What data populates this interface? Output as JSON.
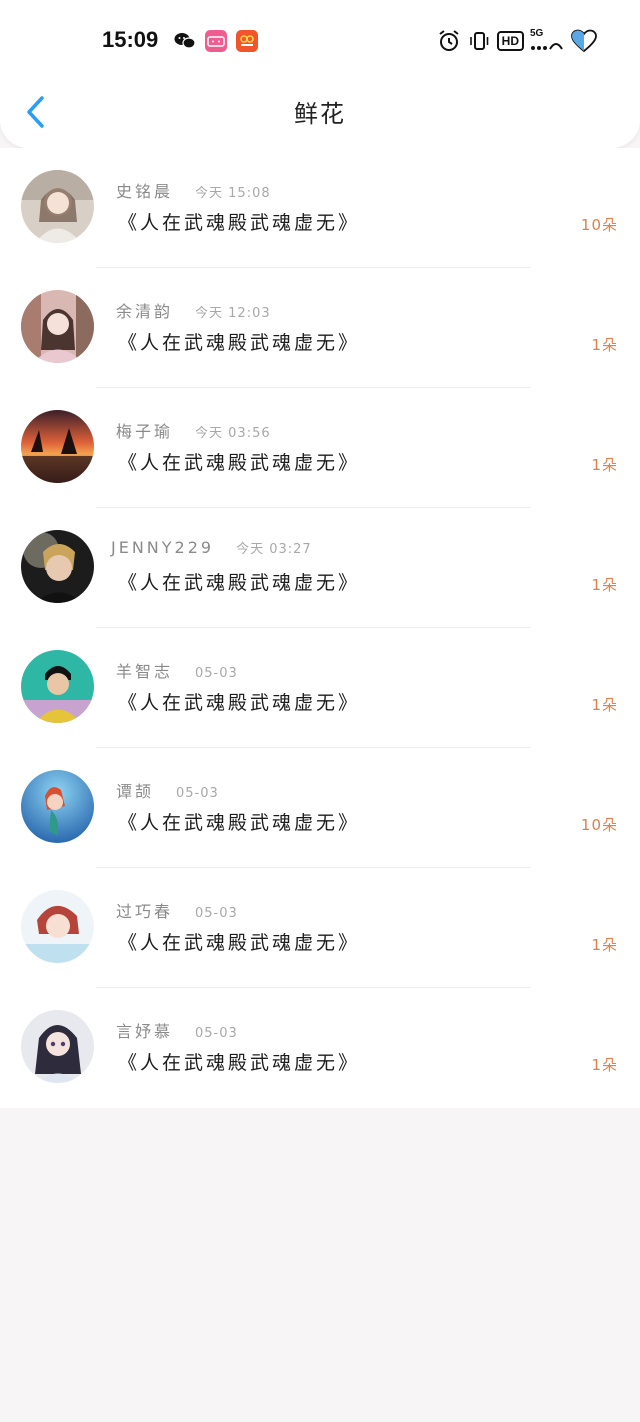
{
  "status_bar": {
    "time": "15:09",
    "apps": [
      "wechat-icon",
      "bilibili-app-icon",
      "shopping-app-icon"
    ],
    "indicators": [
      "alarm-icon",
      "vibrate-icon",
      "hd-icon",
      "signal-5g-icon",
      "battery-icon"
    ],
    "hd_label": "HD",
    "network_label": "5G"
  },
  "nav": {
    "back_icon": "chevron-left-icon",
    "title": "鲜花"
  },
  "colors": {
    "accent": "#2a9df4",
    "amount": "#e0804a",
    "name": "#8a8a8a",
    "time": "#a8a8a8"
  },
  "rows": [
    {
      "name": "史铭晨",
      "time": "今天 15:08",
      "message": "《人在武魂殿武魂虚无》",
      "amount": "10朵"
    },
    {
      "name": "余清韵",
      "time": "今天 12:03",
      "message": "《人在武魂殿武魂虚无》",
      "amount": "1朵"
    },
    {
      "name": "梅子瑜",
      "time": "今天 03:56",
      "message": "《人在武魂殿武魂虚无》",
      "amount": "1朵"
    },
    {
      "name": "JENNY229",
      "time": "今天 03:27",
      "message": "《人在武魂殿武魂虚无》",
      "amount": "1朵"
    },
    {
      "name": "羊智志",
      "time": "05-03",
      "message": "《人在武魂殿武魂虚无》",
      "amount": "1朵"
    },
    {
      "name": "谭颉",
      "time": "05-03",
      "message": "《人在武魂殿武魂虚无》",
      "amount": "10朵"
    },
    {
      "name": "过巧春",
      "time": "05-03",
      "message": "《人在武魂殿武魂虚无》",
      "amount": "1朵"
    },
    {
      "name": "言妤慕",
      "time": "05-03",
      "message": "《人在武魂殿武魂虚无》",
      "amount": "1朵"
    }
  ]
}
